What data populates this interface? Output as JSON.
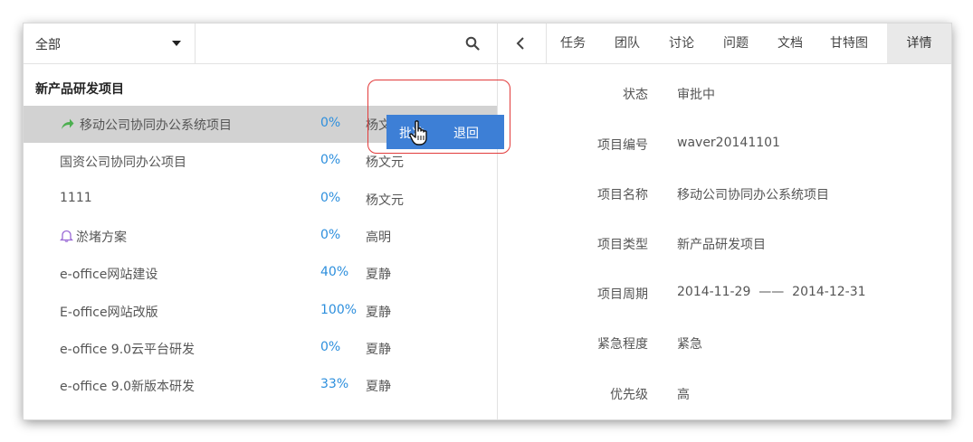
{
  "filter": {
    "selected": "全部"
  },
  "group": {
    "title": "新产品研发项目"
  },
  "projects": [
    {
      "name": "移动公司协同办公系统项目",
      "progress": "0%",
      "owner": "杨文元",
      "icon": "share-arrow-icon"
    },
    {
      "name": "国资公司协同办公项目",
      "progress": "0%",
      "owner": "杨文元"
    },
    {
      "name": "1111",
      "progress": "0%",
      "owner": "杨文元"
    },
    {
      "name": "淤堵方案",
      "progress": "0%",
      "owner": "高明",
      "icon": "bell-icon"
    },
    {
      "name": "e-office网站建设",
      "progress": "40%",
      "owner": "夏静"
    },
    {
      "name": "E-office网站改版",
      "progress": "100%",
      "owner": "夏静"
    },
    {
      "name": "e-office 9.0云平台研发",
      "progress": "0%",
      "owner": "夏静"
    },
    {
      "name": "e-office 9.0新版本研发",
      "progress": "33%",
      "owner": "夏静"
    }
  ],
  "popup": {
    "approve": "批准",
    "reject": "退回"
  },
  "tabs": [
    "任务",
    "团队",
    "讨论",
    "问题",
    "文档",
    "甘特图",
    "详情"
  ],
  "active_tab": "详情",
  "details": {
    "status": {
      "label": "状态",
      "value": "审批中"
    },
    "number": {
      "label": "项目编号",
      "value": "waver20141101"
    },
    "name": {
      "label": "项目名称",
      "value": "移动公司协同办公系统项目"
    },
    "type": {
      "label": "项目类型",
      "value": "新产品研发项目"
    },
    "period": {
      "label": "项目周期",
      "value": "2014-11-29  ——  2014-12-31"
    },
    "urgency": {
      "label": "紧急程度",
      "value": "紧急"
    },
    "priority": {
      "label": "优先级",
      "value": "高"
    }
  },
  "colors": {
    "progress": "#2d8fdd",
    "popup": "#3d7fd6",
    "highlight": "#e23b3b",
    "share_icon": "#4caf50",
    "bell_icon": "#9b6ad6"
  }
}
